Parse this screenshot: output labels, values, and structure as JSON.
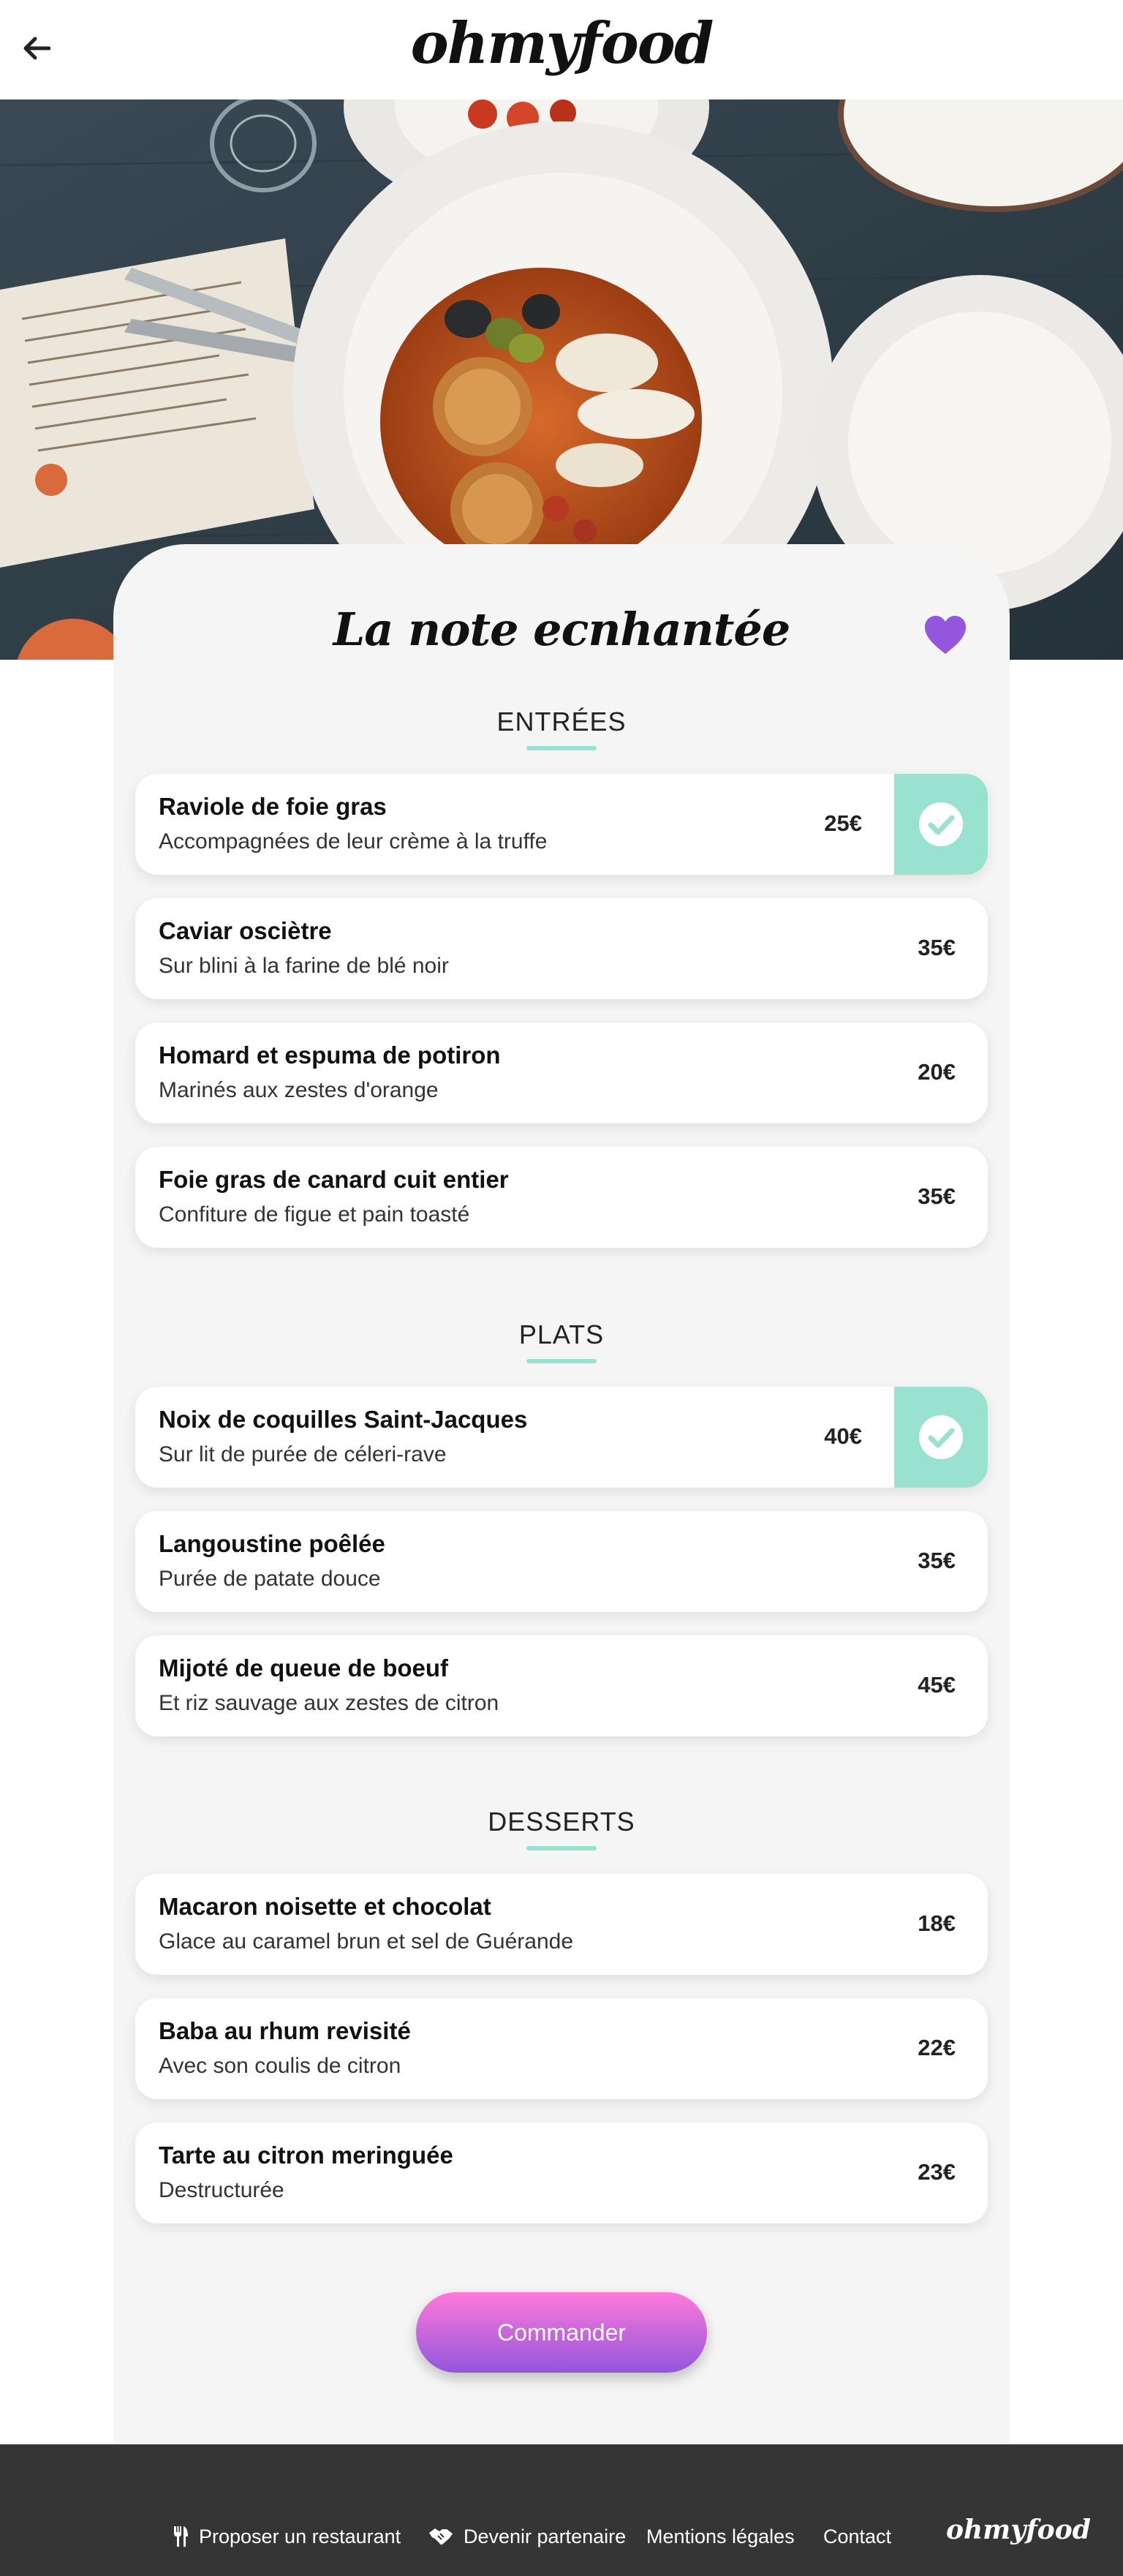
{
  "brand": {
    "logo": "ohmyfood"
  },
  "restaurant": {
    "name": "La note ecnhantée",
    "favorite": true
  },
  "colors": {
    "accent_mint": "#99e2d0",
    "heart": "#9356dc",
    "button_top": "#ff79da",
    "button_bottom": "#9356dc",
    "footer_bg": "#353535"
  },
  "sections": [
    {
      "title": "ENTRÉES",
      "dishes": [
        {
          "name": "Raviole de foie gras",
          "description": "Accompagnées de leur crème à la truffe",
          "price": "25€",
          "selected": true
        },
        {
          "name": "Caviar osciètre",
          "description": "Sur blini à la farine de blé noir",
          "price": "35€",
          "selected": false
        },
        {
          "name": "Homard et espuma de potiron",
          "description": "Marinés aux zestes d'orange",
          "price": "20€",
          "selected": false
        },
        {
          "name": "Foie gras de canard cuit entier",
          "description": "Confiture de figue et pain toasté",
          "price": "35€",
          "selected": false
        }
      ]
    },
    {
      "title": "PLATS",
      "dishes": [
        {
          "name": "Noix de coquilles Saint-Jacques",
          "description": "Sur lit de purée de céleri-rave",
          "price": "40€",
          "selected": true
        },
        {
          "name": "Langoustine poêlée",
          "description": "Purée de patate douce",
          "price": "35€",
          "selected": false
        },
        {
          "name": "Mijoté de queue de boeuf",
          "description": "Et riz sauvage aux zestes de citron",
          "price": "45€",
          "selected": false
        }
      ]
    },
    {
      "title": "DESSERTS",
      "dishes": [
        {
          "name": "Macaron noisette et chocolat",
          "description": "Glace au caramel brun et sel de Guérande",
          "price": "18€",
          "selected": false
        },
        {
          "name": "Baba au rhum revisité",
          "description": "Avec son coulis de citron",
          "price": "22€",
          "selected": false
        },
        {
          "name": "Tarte au citron meringuée",
          "description": "Destructurée",
          "price": "23€",
          "selected": false
        }
      ]
    }
  ],
  "order_button": {
    "label": "Commander"
  },
  "footer": {
    "links": [
      {
        "label": "Proposer un restaurant",
        "icon": "utensils-icon"
      },
      {
        "label": "Devenir partenaire",
        "icon": "handshake-icon"
      },
      {
        "label": "Mentions légales",
        "icon": ""
      },
      {
        "label": "Contact",
        "icon": ""
      }
    ],
    "logo": "ohmyfood"
  }
}
